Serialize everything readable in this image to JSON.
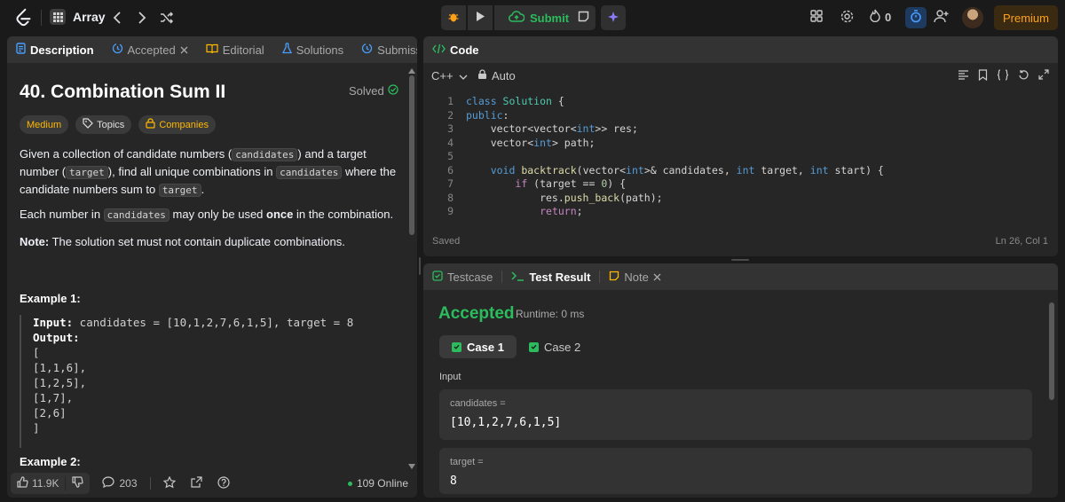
{
  "topbar": {
    "problem_list_label": "Array",
    "submit_label": "Submit",
    "streak_count": "0",
    "premium_label": "Premium"
  },
  "left_panel": {
    "tabs": [
      {
        "label": "Description"
      },
      {
        "label": "Accepted"
      },
      {
        "label": "Editorial"
      },
      {
        "label": "Solutions"
      },
      {
        "label": "Submissions"
      }
    ],
    "title": "40. Combination Sum II",
    "status": "Solved",
    "tags": {
      "difficulty": "Medium",
      "topics": "Topics",
      "companies": "Companies"
    },
    "description": {
      "p1_a": "Given a collection of candidate numbers (",
      "p1_code1": "candidates",
      "p1_b": ") and a target number (",
      "p1_code2": "target",
      "p1_c": "), find all unique combinations in ",
      "p1_code3": "candidates",
      "p1_d": " where the candidate numbers sum to ",
      "p1_code4": "target",
      "p1_e": ".",
      "p2_a": "Each number in ",
      "p2_code": "candidates",
      "p2_b": " may only be used ",
      "p2_bold": "once",
      "p2_c": " in the combination.",
      "note_label": "Note:",
      "note_text": " The solution set must not contain duplicate combinations."
    },
    "example1": {
      "title": "Example 1:",
      "input_label": "Input:",
      "input_value": " candidates = [10,1,2,7,6,1,5], target = 8",
      "output_label": "Output:",
      "output_lines": [
        "[",
        "[1,1,6],",
        "[1,2,5],",
        "[1,7],",
        "[2,6]",
        "]"
      ]
    },
    "example2_title": "Example 2:",
    "footer": {
      "likes": "11.9K",
      "comments": "203",
      "online": "109 Online"
    }
  },
  "code_panel": {
    "title": "Code",
    "language": "C++",
    "auto_label": "Auto",
    "status": "Saved",
    "cursor": "Ln 26, Col 1",
    "lines": [
      {
        "n": "1",
        "parts": [
          [
            "kw",
            "class "
          ],
          [
            "ty",
            "Solution"
          ],
          [
            "tx",
            " {"
          ]
        ]
      },
      {
        "n": "2",
        "parts": [
          [
            "kw",
            "public"
          ],
          [
            "tx",
            ":"
          ]
        ]
      },
      {
        "n": "3",
        "parts": [
          [
            "tx",
            "    vector<vector<"
          ],
          [
            "kw",
            "int"
          ],
          [
            "tx",
            ">> res;"
          ]
        ]
      },
      {
        "n": "4",
        "parts": [
          [
            "tx",
            "    vector<"
          ],
          [
            "kw",
            "int"
          ],
          [
            "tx",
            "> path;"
          ]
        ]
      },
      {
        "n": "5",
        "parts": [
          [
            "tx",
            ""
          ]
        ]
      },
      {
        "n": "6",
        "parts": [
          [
            "tx",
            "    "
          ],
          [
            "kw",
            "void "
          ],
          [
            "fn",
            "backtrack"
          ],
          [
            "tx",
            "(vector<"
          ],
          [
            "kw",
            "int"
          ],
          [
            "tx",
            ">& candidates, "
          ],
          [
            "kw",
            "int"
          ],
          [
            "tx",
            " target, "
          ],
          [
            "kw",
            "int"
          ],
          [
            "tx",
            " start) {"
          ]
        ]
      },
      {
        "n": "7",
        "parts": [
          [
            "tx",
            "        "
          ],
          [
            "kw2",
            "if"
          ],
          [
            "tx",
            " (target == "
          ],
          [
            "nm",
            "0"
          ],
          [
            "tx",
            ") {"
          ]
        ]
      },
      {
        "n": "8",
        "parts": [
          [
            "tx",
            "            res."
          ],
          [
            "fn",
            "push_back"
          ],
          [
            "tx",
            "(path);"
          ]
        ]
      },
      {
        "n": "9",
        "parts": [
          [
            "tx",
            "            "
          ],
          [
            "kw2",
            "return"
          ],
          [
            "tx",
            ";"
          ]
        ]
      }
    ]
  },
  "result_panel": {
    "tabs": [
      {
        "label": "Testcase"
      },
      {
        "label": "Test Result"
      },
      {
        "label": "Note"
      }
    ],
    "verdict": "Accepted",
    "runtime": "Runtime: 0 ms",
    "cases": [
      {
        "label": "Case 1"
      },
      {
        "label": "Case 2"
      }
    ],
    "input_title": "Input",
    "inputs": [
      {
        "label": "candidates =",
        "value": "[10,1,2,7,6,1,5]"
      },
      {
        "label": "target =",
        "value": "8"
      }
    ]
  },
  "colors": {
    "accent_green": "#2cbb5d",
    "medium": "#ffb800",
    "premium": "#ffa116",
    "link_blue": "#4a9eff"
  }
}
